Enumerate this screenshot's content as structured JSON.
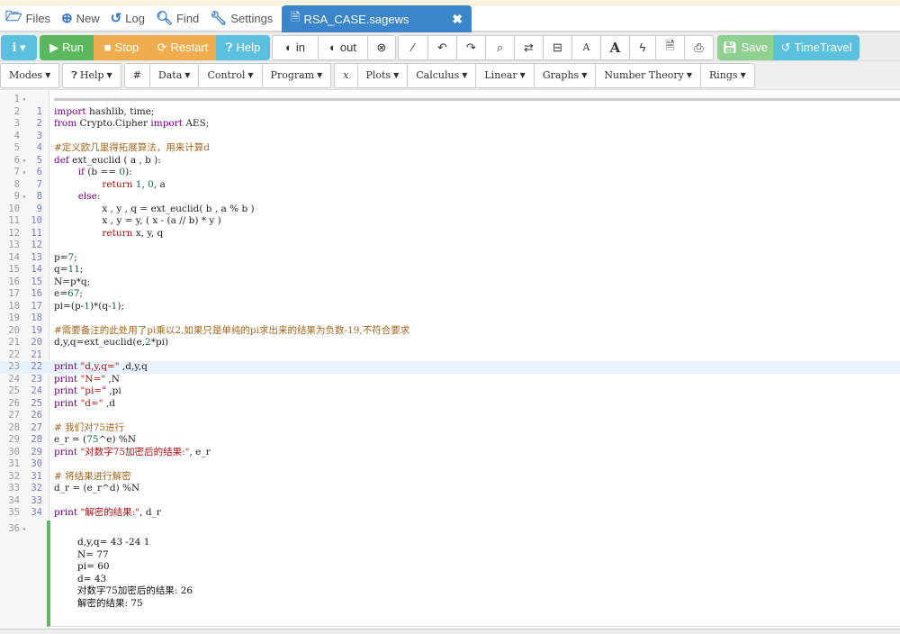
{
  "nav": {
    "files": "Files",
    "new": "New",
    "log": "Log",
    "find": "Find",
    "settings": "Settings",
    "active_tab": "RSA_CASE.sagews",
    "close": "✖"
  },
  "toolbar": {
    "info": "ℹ ▾",
    "run": "Run",
    "stop": "Stop",
    "restart": "Restart",
    "help": "Help",
    "in": "in",
    "out": "out",
    "save": "Save",
    "timetravel": "TimeTravel"
  },
  "menus": [
    {
      "label": "Modes",
      "caret": true
    },
    {
      "label": "Help",
      "caret": true
    },
    {
      "label": "#",
      "caret": false
    },
    {
      "label": "Data",
      "caret": true
    },
    {
      "label": "Control",
      "caret": true
    },
    {
      "label": "Program",
      "caret": true
    },
    {
      "label": "x",
      "caret": false
    },
    {
      "label": "Plots",
      "caret": true
    },
    {
      "label": "Calculus",
      "caret": true
    },
    {
      "label": "Linear",
      "caret": true
    },
    {
      "label": "Graphs",
      "caret": true
    },
    {
      "label": "Number Theory",
      "caret": true
    },
    {
      "label": "Rings",
      "caret": true
    }
  ],
  "code_lines": [
    "import hashlib, time;",
    "from Crypto.Cipher import AES;",
    "",
    "#定义欧几里得拓展算法，用来计算d",
    "def ext_euclid ( a , b ):",
    "        if (b == 0):",
    "                return 1, 0, a",
    "        else:",
    "                x , y , q = ext_euclid( b , a % b )",
    "                x , y = y, ( x - (a // b) * y )",
    "                return x, y, q",
    "",
    "p=7;",
    "q=11;",
    "N=p*q;",
    "e=67;",
    "pi=(p-1)*(q-1);",
    "",
    "#需要备注的此处用了pi乘以2,如果只是单纯的pi求出来的结果为负数-19,不符合要求",
    "d,y,q=ext_euclid(e,2*pi)",
    "",
    "print \"d,y,q=\" ,d,y,q",
    "print \"N=\" ,N",
    "print \"pi=\" ,pi",
    "print \"d=\" ,d",
    "",
    "# 我们对75进行",
    "e_r = (75^e) %N",
    "print \"对数字75加密后的结果:\", e_r",
    "",
    "# 将结果进行解密",
    "d_r = (e_r^d) %N",
    "",
    "print \"解密的结果:\", d_r"
  ],
  "output_lines": [
    "d,y,q= 43 -24 1",
    "N= 77",
    "pi= 60",
    "d= 43",
    "对数字75加密后的结果: 26",
    "解密的结果: 75"
  ],
  "output_cell_number": "36",
  "colors": {
    "tab_active": "#3b86cb",
    "run": "#5cb85c",
    "stop": "#f0ad4e",
    "help": "#5bc0de",
    "output_bar": "#5cb85c"
  }
}
